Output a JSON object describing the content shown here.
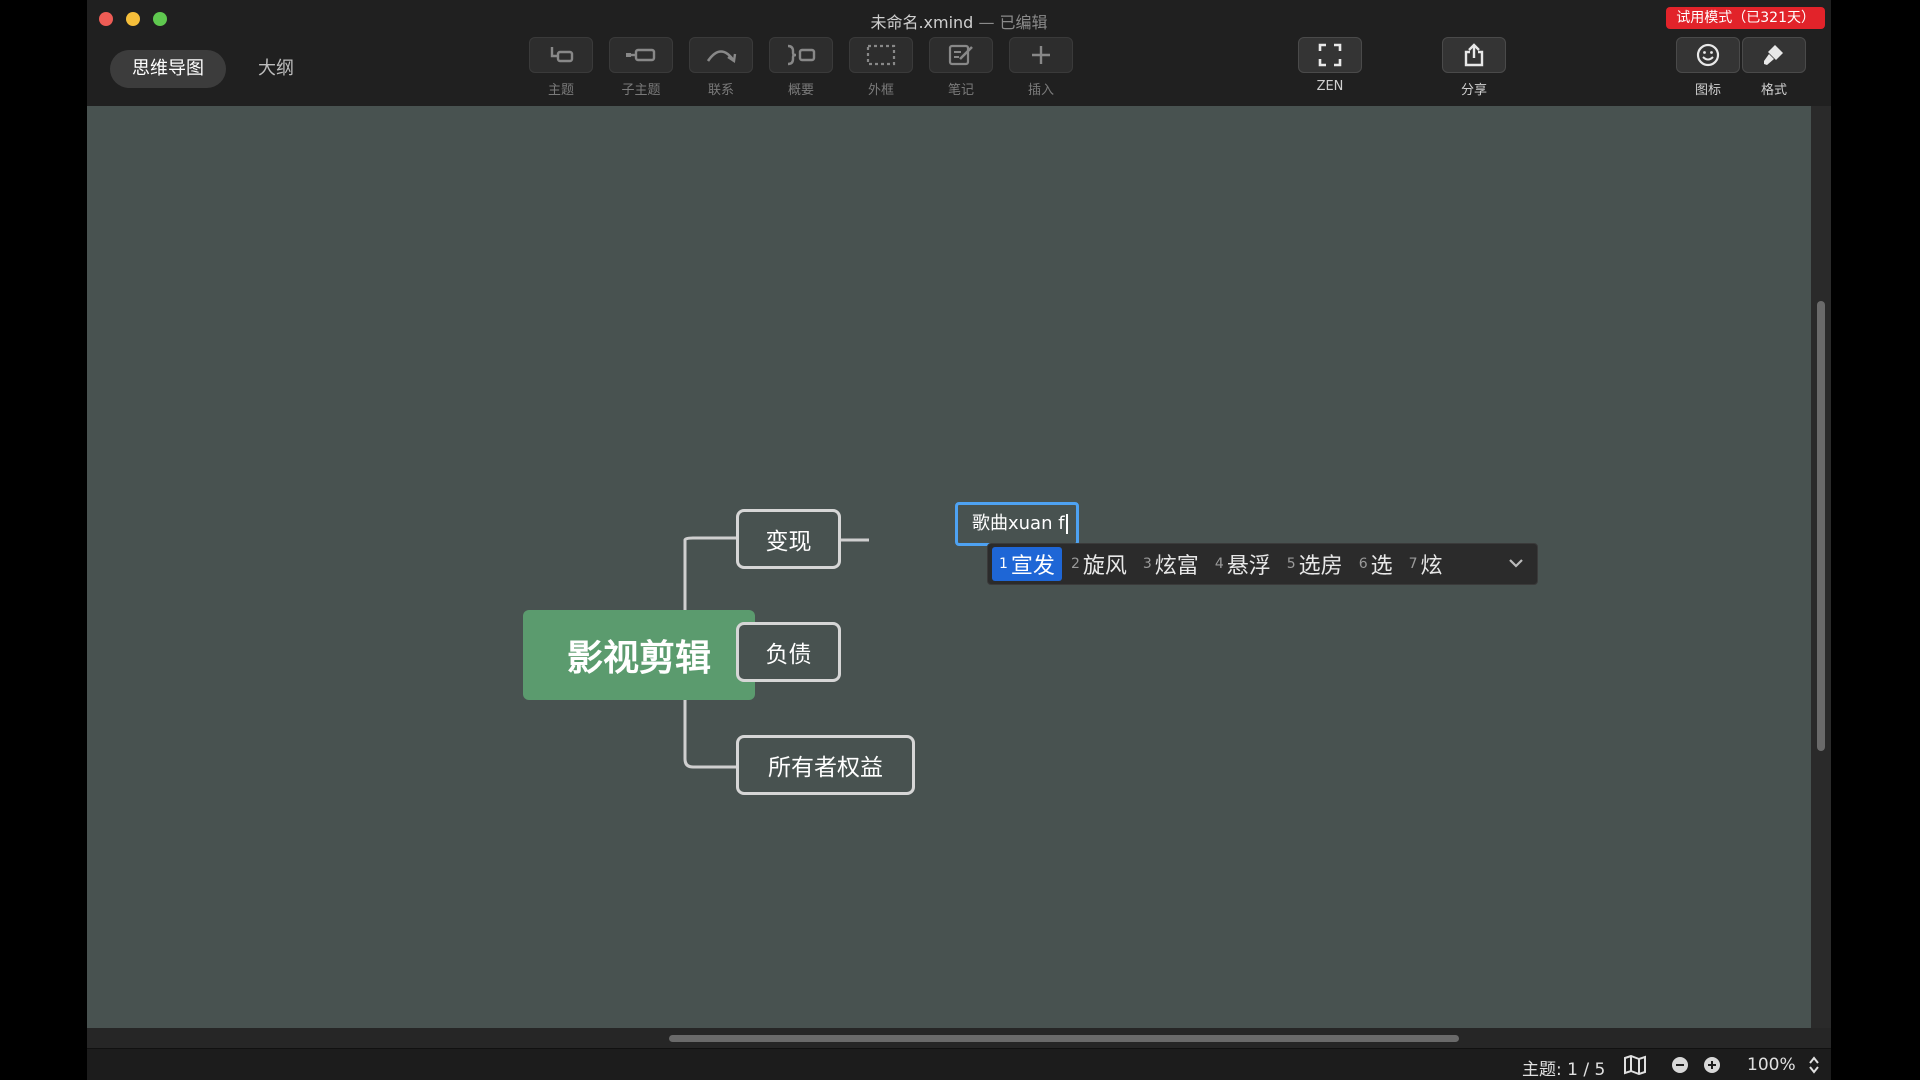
{
  "window": {
    "title": "未命名.xmind",
    "title_status": "— 已编辑",
    "trial_badge": "试用模式（已321天）"
  },
  "view_tabs": [
    {
      "label": "思维导图",
      "active": true
    },
    {
      "label": "大纲",
      "active": false
    }
  ],
  "toolbar": {
    "topic": "主题",
    "subtopic": "子主题",
    "relationship": "联系",
    "summary": "概要",
    "boundary": "外框",
    "note": "笔记",
    "insert": "插入",
    "zen": "ZEN",
    "share": "分享",
    "icon": "图标",
    "format": "格式"
  },
  "mindmap": {
    "central": "影视剪辑",
    "topics": [
      "变现",
      "负债",
      "所有者权益"
    ],
    "editing_text": "歌曲xuan f"
  },
  "ime": {
    "candidates": [
      {
        "num": "1",
        "word": "宣发"
      },
      {
        "num": "2",
        "word": "旋风"
      },
      {
        "num": "3",
        "word": "炫富"
      },
      {
        "num": "4",
        "word": "悬浮"
      },
      {
        "num": "5",
        "word": "选房"
      },
      {
        "num": "6",
        "word": "选"
      },
      {
        "num": "7",
        "word": "炫"
      }
    ]
  },
  "statusbar": {
    "topic_count": "主题: 1 / 5",
    "zoom": "100%"
  },
  "colors": {
    "canvas": "#485250",
    "central_topic": "#5b9b6e",
    "trial_badge": "#e2232a",
    "ime_highlight": "#1e66d6",
    "edit_border": "#4ea2f2"
  }
}
